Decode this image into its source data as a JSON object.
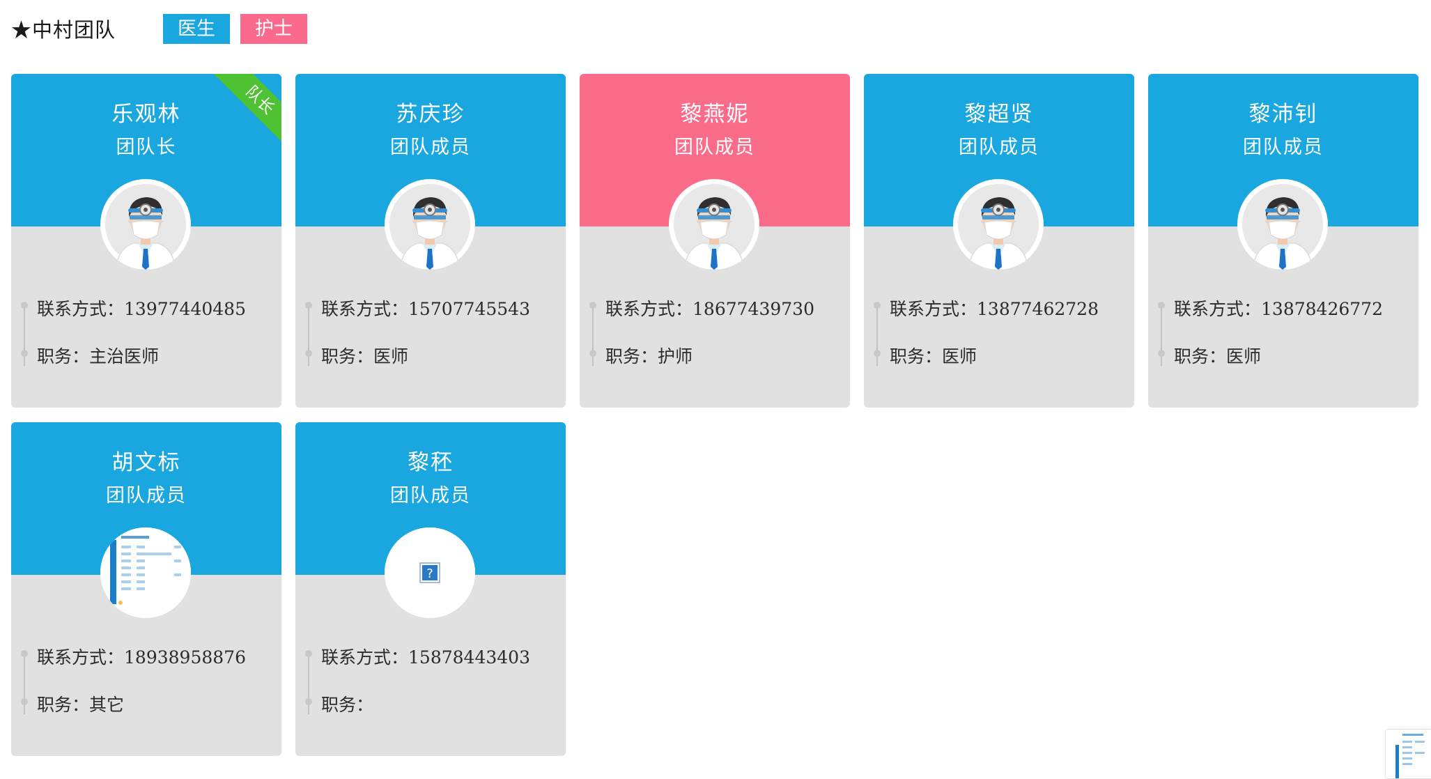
{
  "header": {
    "team_title": "★中村团队",
    "legend_doctor": "医生",
    "legend_nurse": "护士"
  },
  "labels": {
    "contact": "联系方式：",
    "duty": "职务："
  },
  "colors": {
    "doctor": "#1aa7df",
    "nurse": "#fb6c8b",
    "leader_ribbon": "#4ec232",
    "card_body": "#e1e1e1"
  },
  "members": [
    {
      "name": "乐观林",
      "role": "团队长",
      "contact": "13977440485",
      "duty": "主治医师",
      "type": "doctor",
      "ribbon": "队长",
      "avatar": "doctor-avatar-icon"
    },
    {
      "name": "苏庆珍",
      "role": "团队成员",
      "contact": "15707745543",
      "duty": "医师",
      "type": "doctor",
      "ribbon": "",
      "avatar": "doctor-avatar-icon"
    },
    {
      "name": "黎燕妮",
      "role": "团队成员",
      "contact": "18677439730",
      "duty": "护师",
      "type": "nurse",
      "ribbon": "",
      "avatar": "doctor-avatar-icon"
    },
    {
      "name": "黎超贤",
      "role": "团队成员",
      "contact": "13877462728",
      "duty": "医师",
      "type": "doctor",
      "ribbon": "",
      "avatar": "doctor-avatar-icon"
    },
    {
      "name": "黎沛钊",
      "role": "团队成员",
      "contact": "13878426772",
      "duty": "医师",
      "type": "doctor",
      "ribbon": "",
      "avatar": "doctor-avatar-icon"
    },
    {
      "name": "胡文标",
      "role": "团队成员",
      "contact": "18938958876",
      "duty": "其它",
      "type": "doctor",
      "ribbon": "",
      "avatar": "screenshot-thumbnail-icon"
    },
    {
      "name": "黎秠",
      "role": "团队成员",
      "contact": "15878443403",
      "duty": "",
      "type": "doctor",
      "ribbon": "",
      "avatar": "broken-image-icon"
    }
  ]
}
